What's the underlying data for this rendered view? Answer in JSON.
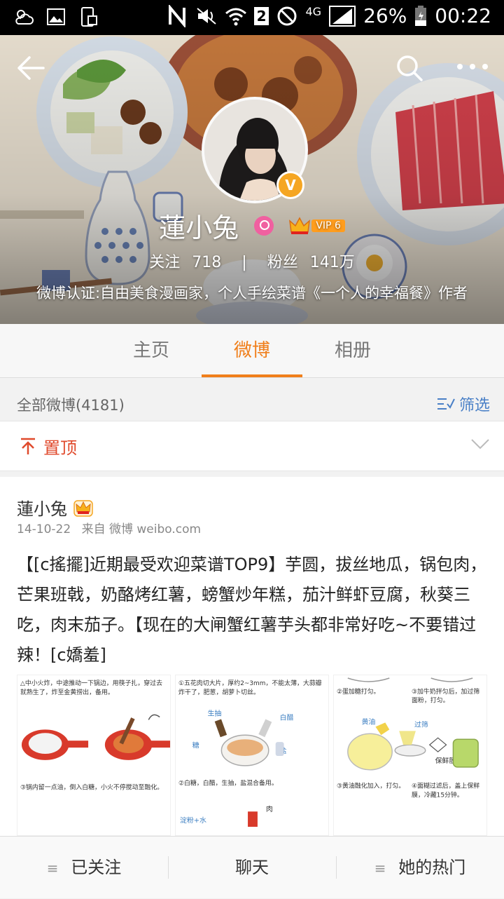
{
  "status_bar": {
    "network": "4G",
    "sim": "2",
    "battery": "26%",
    "time": "00:22"
  },
  "profile": {
    "name": "蓮小兔",
    "vip_label": "VIP 6",
    "follow_label": "关注",
    "follow_count": "718",
    "fans_label": "粉丝",
    "fans_count": "141万",
    "certification": "微博认证:自由美食漫画家，个人手绘菜谱《一个人的幸福餐》作者"
  },
  "tabs": [
    "主页",
    "微博",
    "相册"
  ],
  "active_tab": 1,
  "filter": {
    "count_label": "全部微博(4181)",
    "filter_label": "筛选"
  },
  "pinned": {
    "label": "置顶"
  },
  "post": {
    "author": "蓮小兔",
    "date": "14-10-22",
    "source": "来自 微博 weibo.com",
    "text": "【[c搖擺]近期最受欢迎菜谱TOP9】芋圆，拔丝地瓜，锅包肉，芒果班戟，奶酪烤红薯，螃蟹炒年糕，茄汁鲜虾豆腐，秋葵三吃，肉末茄子。【现在的大闸蟹红薯芋头都非常好吃~不要错过辣！[c嬌羞]",
    "images": [
      {
        "caption1": "△中小火炸，中途推动一下锅边，用筷子扎，穿过去就熟生了，炸至金黄捞出，备用。",
        "caption2": "③锅内留一点油，倒入白糖，小火不停搅动至融化。"
      },
      {
        "caption1": "①五花肉切大片，厚约2~3mm，不能太薄，大蒜瓣炸干了，肥葱，胡萝卜切丝。",
        "labels": [
          "生抽",
          "白醋",
          "糖",
          "盐"
        ],
        "caption2": "②白糖，白醋，生抽，盐混合备用。",
        "labels2": [
          "淀粉+水",
          "肉"
        ]
      },
      {
        "caption1a": "②蛋加糖打匀。",
        "caption1b": "③加牛奶拌匀后，加过筛面粉，打匀。",
        "labels": [
          "黄油",
          "过筛",
          "保鲜膜"
        ],
        "caption2a": "③黄油融化加入，打匀。",
        "caption2b": "④面糊过滤后，盖上保鲜膜，冷藏15分钟。"
      }
    ]
  },
  "bottom_bar": [
    "已关注",
    "聊天",
    "她的热门"
  ]
}
